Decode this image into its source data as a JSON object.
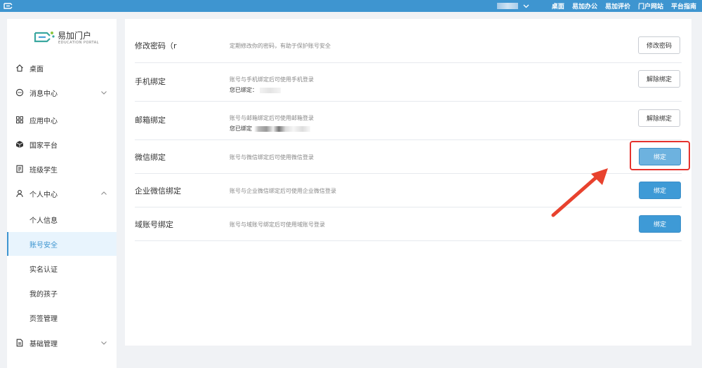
{
  "topbar": {
    "nav": [
      "桌面",
      "易加办公",
      "易加评价",
      "门户网站",
      "平台指南"
    ],
    "bg": "#3e95d0"
  },
  "sidebar": {
    "brand": {
      "name": "易加门户",
      "sub": "EDUCATION PORTAL"
    },
    "items": [
      {
        "label": "桌面",
        "icon": "home-icon"
      },
      {
        "label": "消息中心",
        "icon": "message-icon",
        "chevron": "down"
      },
      {
        "label": "应用中心",
        "icon": "grid-icon"
      },
      {
        "label": "国家平台",
        "icon": "cube-icon"
      },
      {
        "label": "班级学生",
        "icon": "doc-icon"
      },
      {
        "label": "个人中心",
        "icon": "user-icon",
        "chevron": "up"
      },
      {
        "label": "基础管理",
        "icon": "file-icon",
        "chevron": "down"
      }
    ],
    "sub_items": [
      {
        "label": "个人信息"
      },
      {
        "label": "账号安全",
        "active": true
      },
      {
        "label": "实名认证"
      },
      {
        "label": "我的孩子"
      },
      {
        "label": "页签管理"
      }
    ]
  },
  "security": {
    "rows": [
      {
        "title": "修改密码（r",
        "desc": "定期修改你的密码，有助于保护账号安全",
        "button": "修改密码",
        "style": "outline"
      },
      {
        "title": "手机绑定",
        "desc": "账号与手机绑定后可使用手机登录",
        "bound_label": "您已绑定：",
        "button": "解除绑定",
        "style": "outline"
      },
      {
        "title": "邮箱绑定",
        "desc": "账号与邮箱绑定后可使用邮箱登录",
        "bound_label": "您已绑定",
        "button": "解除绑定",
        "style": "outline"
      },
      {
        "title": "微信绑定",
        "desc": "账号与微信绑定后可使用微信登录",
        "button": "绑定",
        "style": "primary"
      },
      {
        "title": "企业微信绑定",
        "desc": "账号与企业微信绑定后可使用企业微信登录",
        "button": "绑定",
        "style": "primary"
      },
      {
        "title": "域账号绑定",
        "desc": "账号与域账号绑定后可使用域账号登录",
        "button": "绑定",
        "style": "primary"
      }
    ]
  },
  "colors": {
    "accent": "#3e95d0",
    "annotation": "#e5322d"
  }
}
